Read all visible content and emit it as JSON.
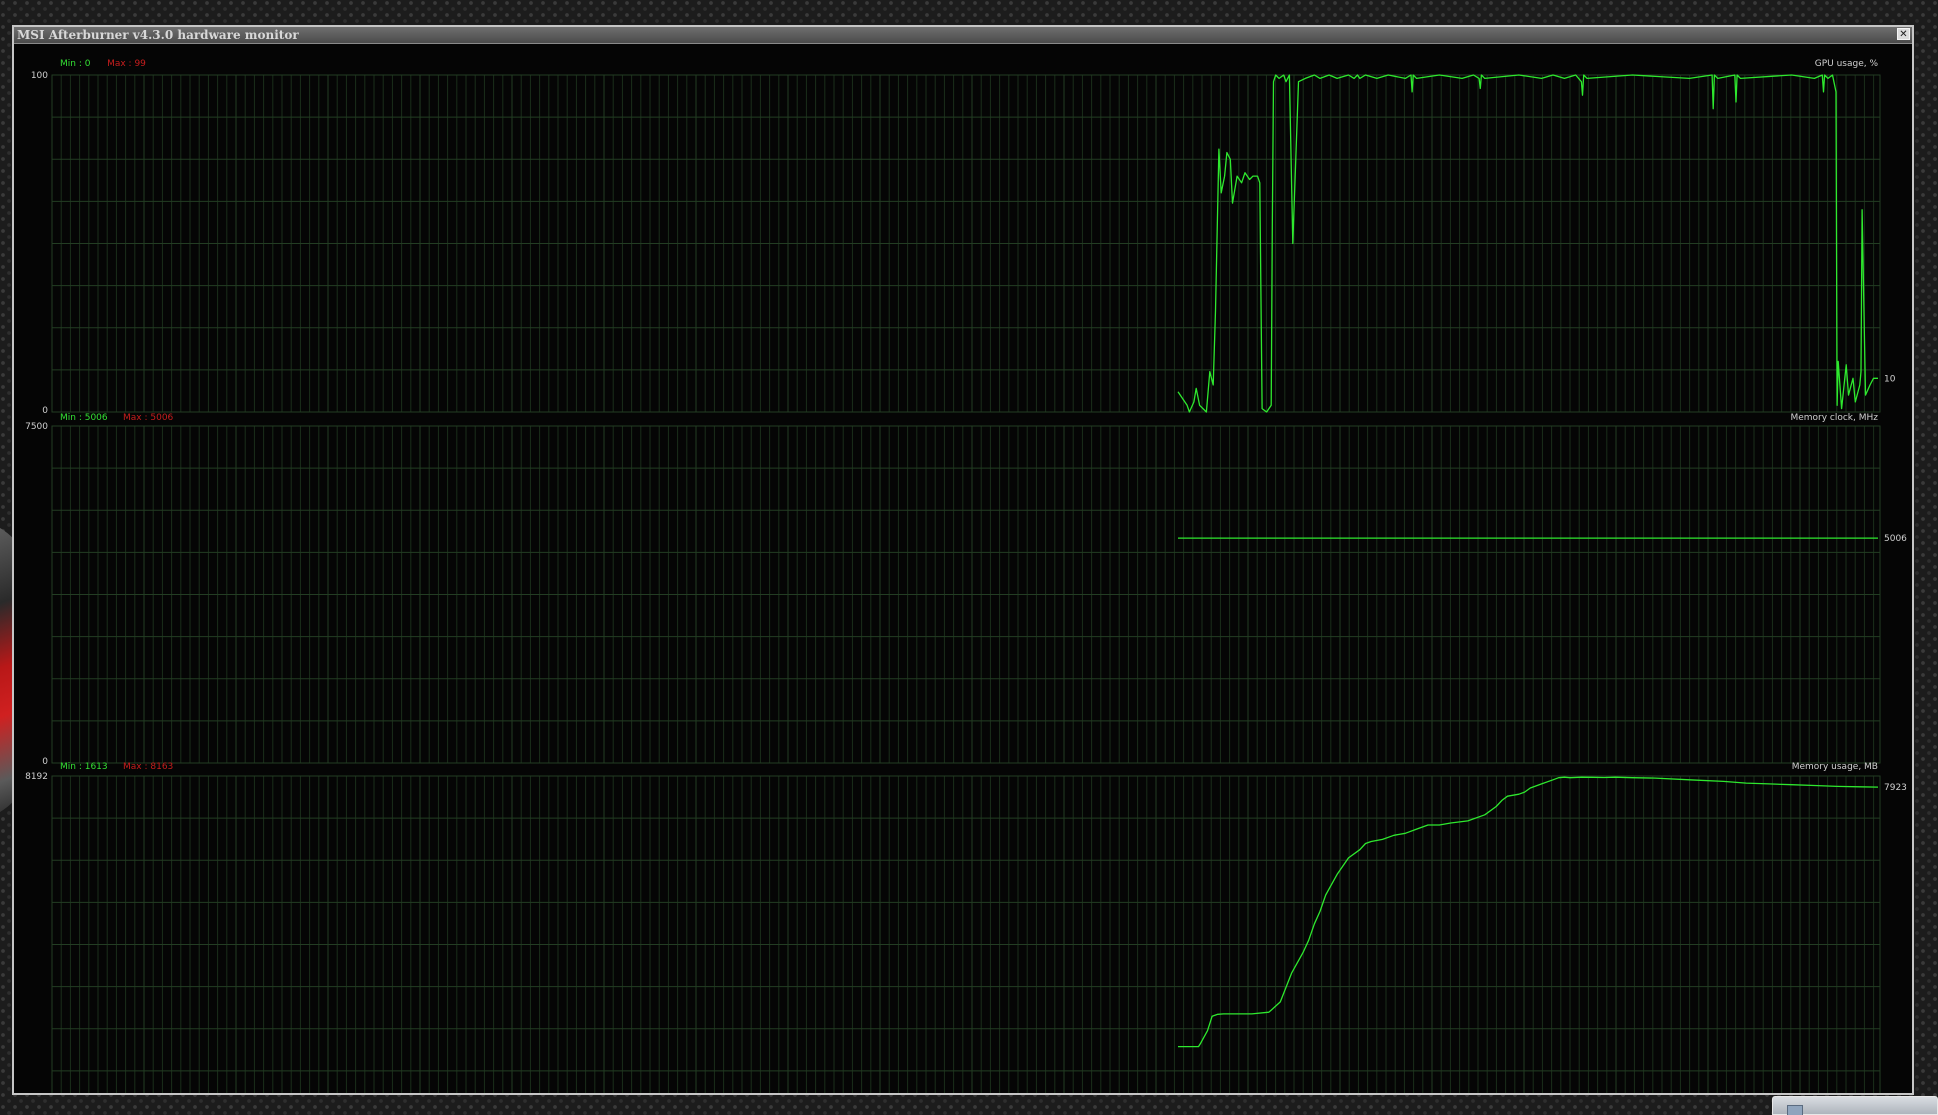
{
  "window": {
    "title": "MSI Afterburner v4.3.0 hardware monitor",
    "close_glyph": "✕"
  },
  "colors": {
    "line": "#2ee82e",
    "min_text": "#34e034",
    "max_text": "#c81e1e",
    "label_text": "#d0d0d0",
    "grid": "#1a2e1a",
    "grid_major": "#233d23",
    "panel_bg": "#050505"
  },
  "chart_data": [
    {
      "type": "line",
      "title": "GPU usage, %",
      "min_label": "Min : 0",
      "max_label": "Max : 99",
      "ylim": [
        0,
        100
      ],
      "ytick_top": "100",
      "ytick_bottom": "0",
      "current_value": "10",
      "x": [
        0,
        8,
        10,
        14,
        16,
        19,
        22,
        25,
        28,
        31,
        33,
        36,
        38,
        41,
        43,
        46,
        48,
        52,
        56,
        59,
        63,
        66,
        70,
        72,
        74,
        78,
        82,
        83,
        84,
        86,
        89,
        93,
        95,
        98,
        101,
        106,
        112,
        120,
        125,
        133,
        140,
        150,
        155,
        158,
        160,
        165,
        175,
        185,
        200,
        205,
        206,
        207,
        210,
        230,
        250,
        260,
        265,
        266,
        267,
        270,
        300,
        320,
        330,
        340,
        350,
        355,
        356,
        357,
        360,
        400,
        450,
        470,
        471,
        472,
        475,
        490,
        491,
        492,
        495,
        540,
        560,
        567,
        568,
        569,
        572,
        576,
        579,
        580,
        581,
        584,
        588,
        590,
        594,
        596,
        600,
        601,
        602,
        605,
        609,
        612,
        616
      ],
      "y": [
        6,
        2,
        0,
        3,
        7,
        2,
        1,
        0,
        12,
        8,
        30,
        78,
        65,
        70,
        77,
        75,
        62,
        70,
        68,
        71,
        69,
        70,
        70,
        68,
        1,
        0,
        2,
        55,
        98,
        100,
        99,
        100,
        98,
        100,
        50,
        98,
        99,
        100,
        99,
        100,
        99,
        100,
        99,
        100,
        99,
        100,
        99,
        100,
        99,
        100,
        95,
        100,
        99,
        100,
        99,
        100,
        99,
        96,
        100,
        99,
        100,
        99,
        100,
        99,
        100,
        98,
        94,
        100,
        99,
        100,
        99,
        100,
        90,
        100,
        99,
        100,
        92,
        100,
        99,
        100,
        99,
        100,
        95,
        100,
        99,
        100,
        95,
        2,
        15,
        1,
        14,
        5,
        10,
        3,
        8,
        12,
        60,
        5,
        8,
        10,
        10
      ]
    },
    {
      "type": "line",
      "title": "Memory clock, MHz",
      "min_label": "Min : 5006",
      "max_label": "Max : 5006",
      "ylim": [
        0,
        7500
      ],
      "ytick_top": "7500",
      "ytick_bottom": "0",
      "current_value": "5006",
      "x": [
        0,
        616
      ],
      "y": [
        5006,
        5006
      ]
    },
    {
      "type": "line",
      "title": "Memory usage, MB",
      "min_label": "Min : 1613",
      "max_label": "Max : 8163",
      "ylim": [
        0,
        8192
      ],
      "ytick_top": "8192",
      "ytick_bottom": "0",
      "current_value": "7923",
      "x": [
        0,
        18,
        20,
        26,
        30,
        35,
        40,
        45,
        65,
        80,
        90,
        100,
        110,
        115,
        120,
        125,
        130,
        140,
        150,
        160,
        165,
        170,
        180,
        190,
        200,
        210,
        220,
        230,
        240,
        255,
        270,
        280,
        285,
        290,
        300,
        305,
        310,
        320,
        330,
        335,
        340,
        345,
        355,
        365,
        375,
        385,
        400,
        420,
        450,
        480,
        500,
        520,
        540,
        560,
        580,
        600,
        616
      ],
      "y": [
        1613,
        1613,
        1700,
        2000,
        2350,
        2400,
        2410,
        2410,
        2410,
        2450,
        2700,
        3400,
        3900,
        4200,
        4600,
        4900,
        5300,
        5800,
        6200,
        6400,
        6550,
        6600,
        6650,
        6750,
        6800,
        6900,
        7000,
        7000,
        7050,
        7100,
        7250,
        7450,
        7600,
        7700,
        7750,
        7800,
        7900,
        8000,
        8100,
        8150,
        8163,
        8150,
        8163,
        8160,
        8155,
        8163,
        8150,
        8140,
        8100,
        8060,
        8020,
        8000,
        7980,
        7960,
        7940,
        7930,
        7923
      ]
    }
  ]
}
